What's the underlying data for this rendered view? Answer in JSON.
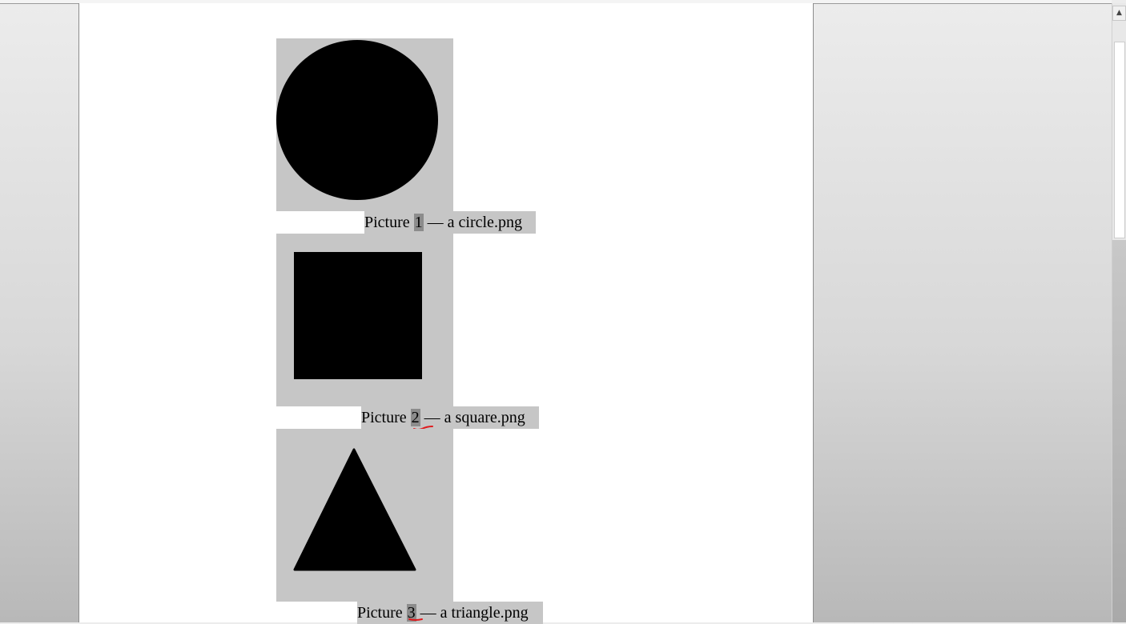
{
  "document": {
    "figures": [
      {
        "shape": "circle",
        "caption": {
          "prefix": "Picture ",
          "number": "1",
          "suffix": " — a circle.png"
        }
      },
      {
        "shape": "square",
        "caption": {
          "prefix": "Picture ",
          "number": "2",
          "suffix": " — a square.png"
        }
      },
      {
        "shape": "triangle",
        "caption": {
          "prefix": "Picture ",
          "number": "3",
          "suffix": " — a triangle.png"
        }
      }
    ]
  },
  "scrollbar": {
    "up_arrow_icon": "triangle-up-icon",
    "up_glyph": "▲"
  },
  "colors": {
    "image_background": "#c6c6c6",
    "field_shading": "#8c8c8c",
    "annotation": "#e0191c"
  }
}
